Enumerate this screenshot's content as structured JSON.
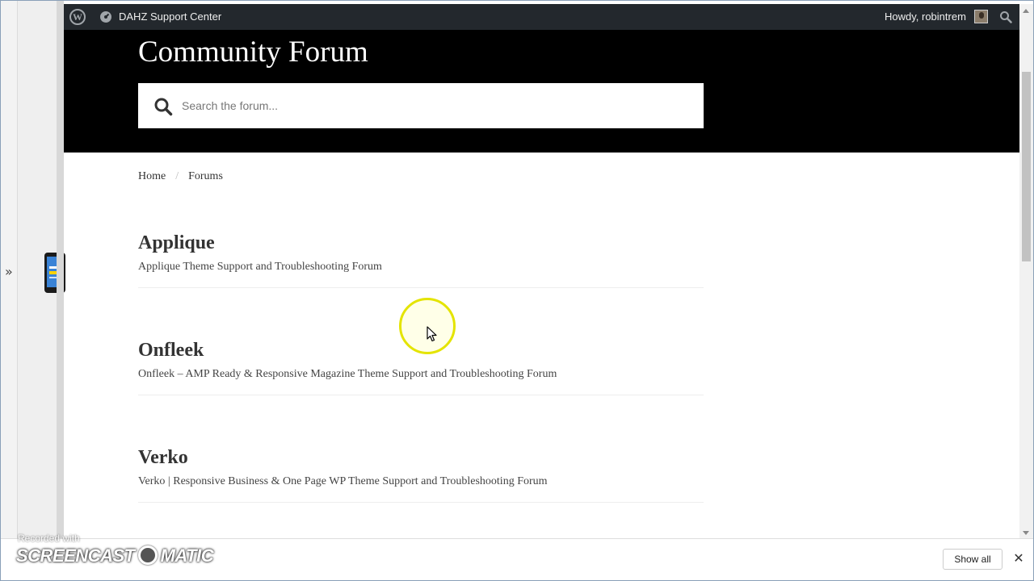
{
  "admin_bar": {
    "site_name": "DAHZ Support Center",
    "howdy": "Howdy, robintrem"
  },
  "hero": {
    "title": "Community Forum",
    "search_placeholder": "Search the forum..."
  },
  "breadcrumb": {
    "home": "Home",
    "separator": "/",
    "current": "Forums"
  },
  "forums": [
    {
      "title": "Applique",
      "description": "Applique Theme Support and Troubleshooting Forum"
    },
    {
      "title": "Onfleek",
      "description": "Onfleek – AMP Ready & Responsive Magazine Theme Support and Troubleshooting Forum"
    },
    {
      "title": "Verko",
      "description": "Verko | Responsive Business & One Page WP Theme Support and Troubleshooting Forum"
    }
  ],
  "download_bar": {
    "show_all": "Show all",
    "close": "✕"
  },
  "side_panel": {
    "expand": "»"
  },
  "watermark": {
    "recorded_with": "Recorded with",
    "brand_left": "SCREENCAST",
    "brand_right": "MATIC"
  },
  "icons": {
    "wordpress": "wordpress-icon",
    "dashboard": "gauge-icon",
    "search": "search-icon",
    "avatar": "avatar",
    "phone": "phone-icon"
  },
  "colors": {
    "admin_bar_bg": "#23282d",
    "hero_bg": "#000000",
    "cursor_highlight": "#e4e400"
  }
}
